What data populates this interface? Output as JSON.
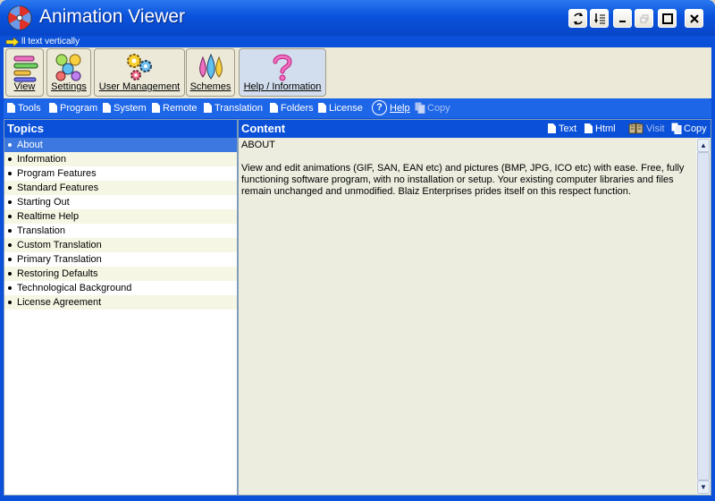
{
  "window": {
    "title": "Animation Viewer",
    "title_buttons": [
      "refresh-vertical",
      "text-vertical",
      "minimize",
      "restore",
      "maximize",
      "close"
    ]
  },
  "hint": {
    "text": "ll text vertically"
  },
  "toolbar": {
    "buttons": [
      {
        "label": "View",
        "icon": "view-icon"
      },
      {
        "label": "Settings",
        "icon": "settings-icon"
      },
      {
        "label": "User Management",
        "icon": "user-management-icon"
      },
      {
        "label": "Schemes",
        "icon": "schemes-icon"
      },
      {
        "label": "Help / Information",
        "icon": "help-icon",
        "active": true
      }
    ]
  },
  "linkbar": {
    "links": [
      "Tools",
      "Program",
      "System",
      "Remote",
      "Translation",
      "Folders",
      "License"
    ],
    "help": "Help",
    "copy": "Copy"
  },
  "topics": {
    "header": "Topics",
    "items": [
      "About",
      "Information",
      "Program Features",
      "Standard Features",
      "Starting Out",
      "Realtime Help",
      "Translation",
      "Custom Translation",
      "Primary Translation",
      "Restoring Defaults",
      "Technological Background",
      "License Agreement"
    ],
    "selected": "About"
  },
  "content": {
    "header": "Content",
    "actions": {
      "text": "Text",
      "html": "Html",
      "visit": "Visit",
      "copy": "Copy"
    },
    "heading": "ABOUT",
    "paragraph": "View and edit animations (GIF, SAN, EAN etc) and pictures (BMP, JPG, ICO etc) with ease. Free, fully functioning software program, with no installation or setup. Your existing computer libraries and files remain unchanged and unmodified.  Blaiz Enterprises prides itself on this respect function."
  },
  "colors": {
    "titlebar": "#0a52dc",
    "panel_header": "#0a50d8",
    "selection": "#3c78e0",
    "content_bg": "#ecedde",
    "toolbar_bg": "#ece9d8"
  }
}
